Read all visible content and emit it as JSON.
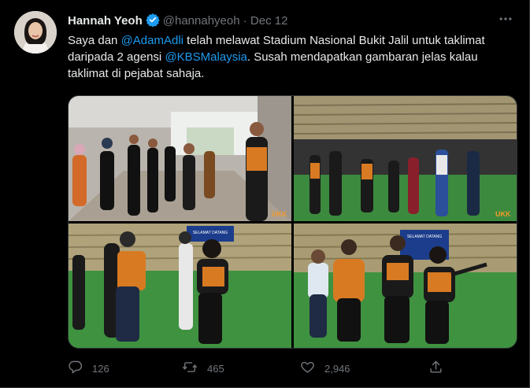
{
  "tweet": {
    "display_name": "Hannah Yeoh",
    "handle": "@hannahyeoh",
    "separator": "·",
    "date": "Dec 12",
    "more_icon": "more-horizontal-icon",
    "text": {
      "part1": "Saya dan ",
      "mention1": "@AdamAdli",
      "part2": " telah melawat Stadium Nasional Bukit Jalil untuk taklimat daripada 2 agensi ",
      "mention2": "@KBSMalaysia",
      "part3": ". Susah mendapatkan gambaran jelas kalau taklimat di pejabat sahaja."
    },
    "photos": [
      {
        "overlay": "UKK"
      },
      {
        "overlay": "UKK"
      },
      {
        "banner": "SELAMAT DATANG"
      },
      {
        "banner": "SELAMAT DATANG"
      }
    ],
    "actions": {
      "replies": "126",
      "retweets": "465",
      "likes": "2,946"
    }
  },
  "colors": {
    "background": "#000000",
    "text": "#e7e9ea",
    "muted": "#71767b",
    "accent": "#1d9bf0"
  }
}
